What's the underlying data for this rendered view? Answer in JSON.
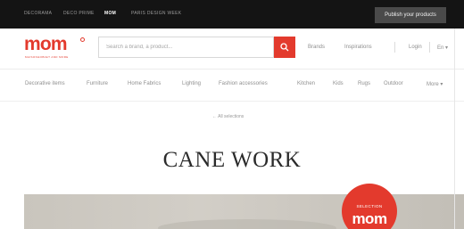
{
  "topbar": {
    "links": [
      "DECORAMA",
      "DECO PRIME",
      "MOM",
      "PARIS DESIGN WEEK"
    ],
    "active_index": 2,
    "publish_label": "Publish your products"
  },
  "brand": {
    "logo": "mom",
    "tagline": "MAISON&OBJET AND MORE"
  },
  "search": {
    "placeholder": "Search a brand, a product..."
  },
  "header_links": {
    "brands": "Brands",
    "inspirations": "Inspirations",
    "login": "Login",
    "language": "En"
  },
  "nav": {
    "items": [
      "Decorative items",
      "Furniture",
      "Home Fabrics",
      "Lighting",
      "Fashion accessories",
      "Kitchen",
      "Kids",
      "Rugs",
      "Outdoor",
      "More"
    ]
  },
  "back_link": "← All selections",
  "page_title": "CANE WORK",
  "badge": {
    "small": "SELECTION",
    "big": "mom"
  },
  "colors": {
    "accent": "#e33a2d",
    "topbar": "#141414"
  }
}
